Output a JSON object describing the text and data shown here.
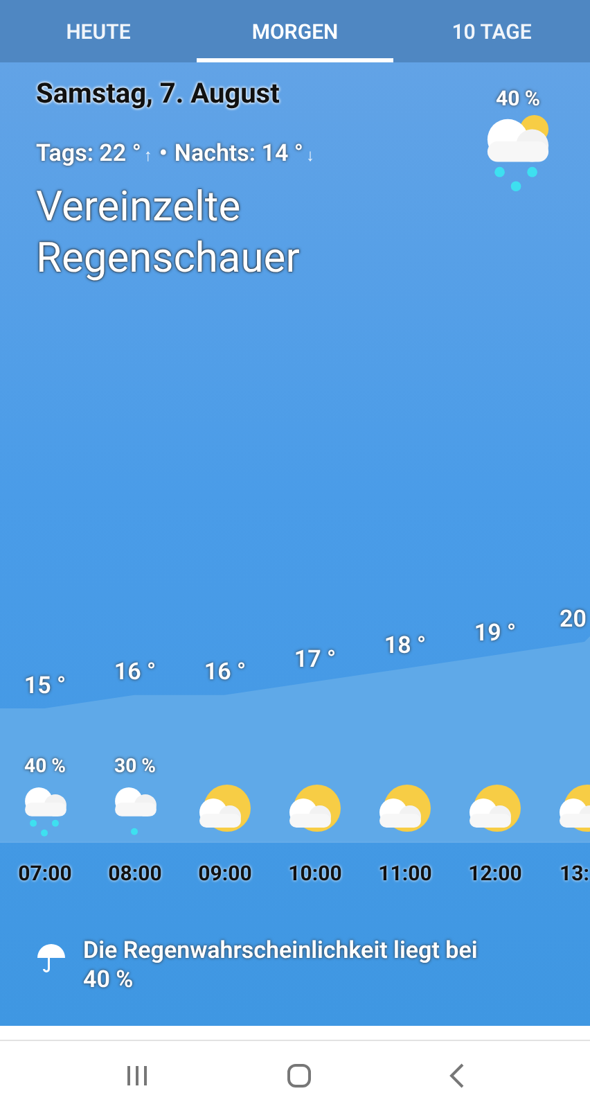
{
  "tabs": [
    {
      "label": "HEUTE",
      "selected": false
    },
    {
      "label": "MORGEN",
      "selected": true
    },
    {
      "label": "10 TAGE",
      "selected": false
    }
  ],
  "day": {
    "date": "Samstag, 7. August",
    "high": "Tags: 22 °",
    "high_arrow": "↑",
    "separator": "•",
    "low": "Nachts: 14 °",
    "low_arrow": "↓",
    "condition": "Vereinzelte Regenschauer",
    "precip": "40 %",
    "kind": "sun-cloud-rain"
  },
  "hourly": [
    {
      "time": "07:00",
      "temp": "15 °",
      "precip": "40 %",
      "kind": "rain"
    },
    {
      "time": "08:00",
      "temp": "16 °",
      "precip": "30 %",
      "kind": "drizzle"
    },
    {
      "time": "09:00",
      "temp": "16 °",
      "kind": "sun-cloud"
    },
    {
      "time": "10:00",
      "temp": "17 °",
      "kind": "sun-cloud"
    },
    {
      "time": "11:00",
      "temp": "18 °",
      "kind": "sun-cloud"
    },
    {
      "time": "12:00",
      "temp": "19 °",
      "kind": "sun-cloud"
    },
    {
      "time": "13:",
      "temp": "20",
      "kind": "sun-cloud"
    }
  ],
  "footer": {
    "text": "Die Regenwahrscheinlichkeit liegt bei 40 %"
  },
  "nav_bar": [
    {
      "kind": "recent"
    },
    {
      "kind": "home"
    },
    {
      "kind": "back"
    }
  ]
}
